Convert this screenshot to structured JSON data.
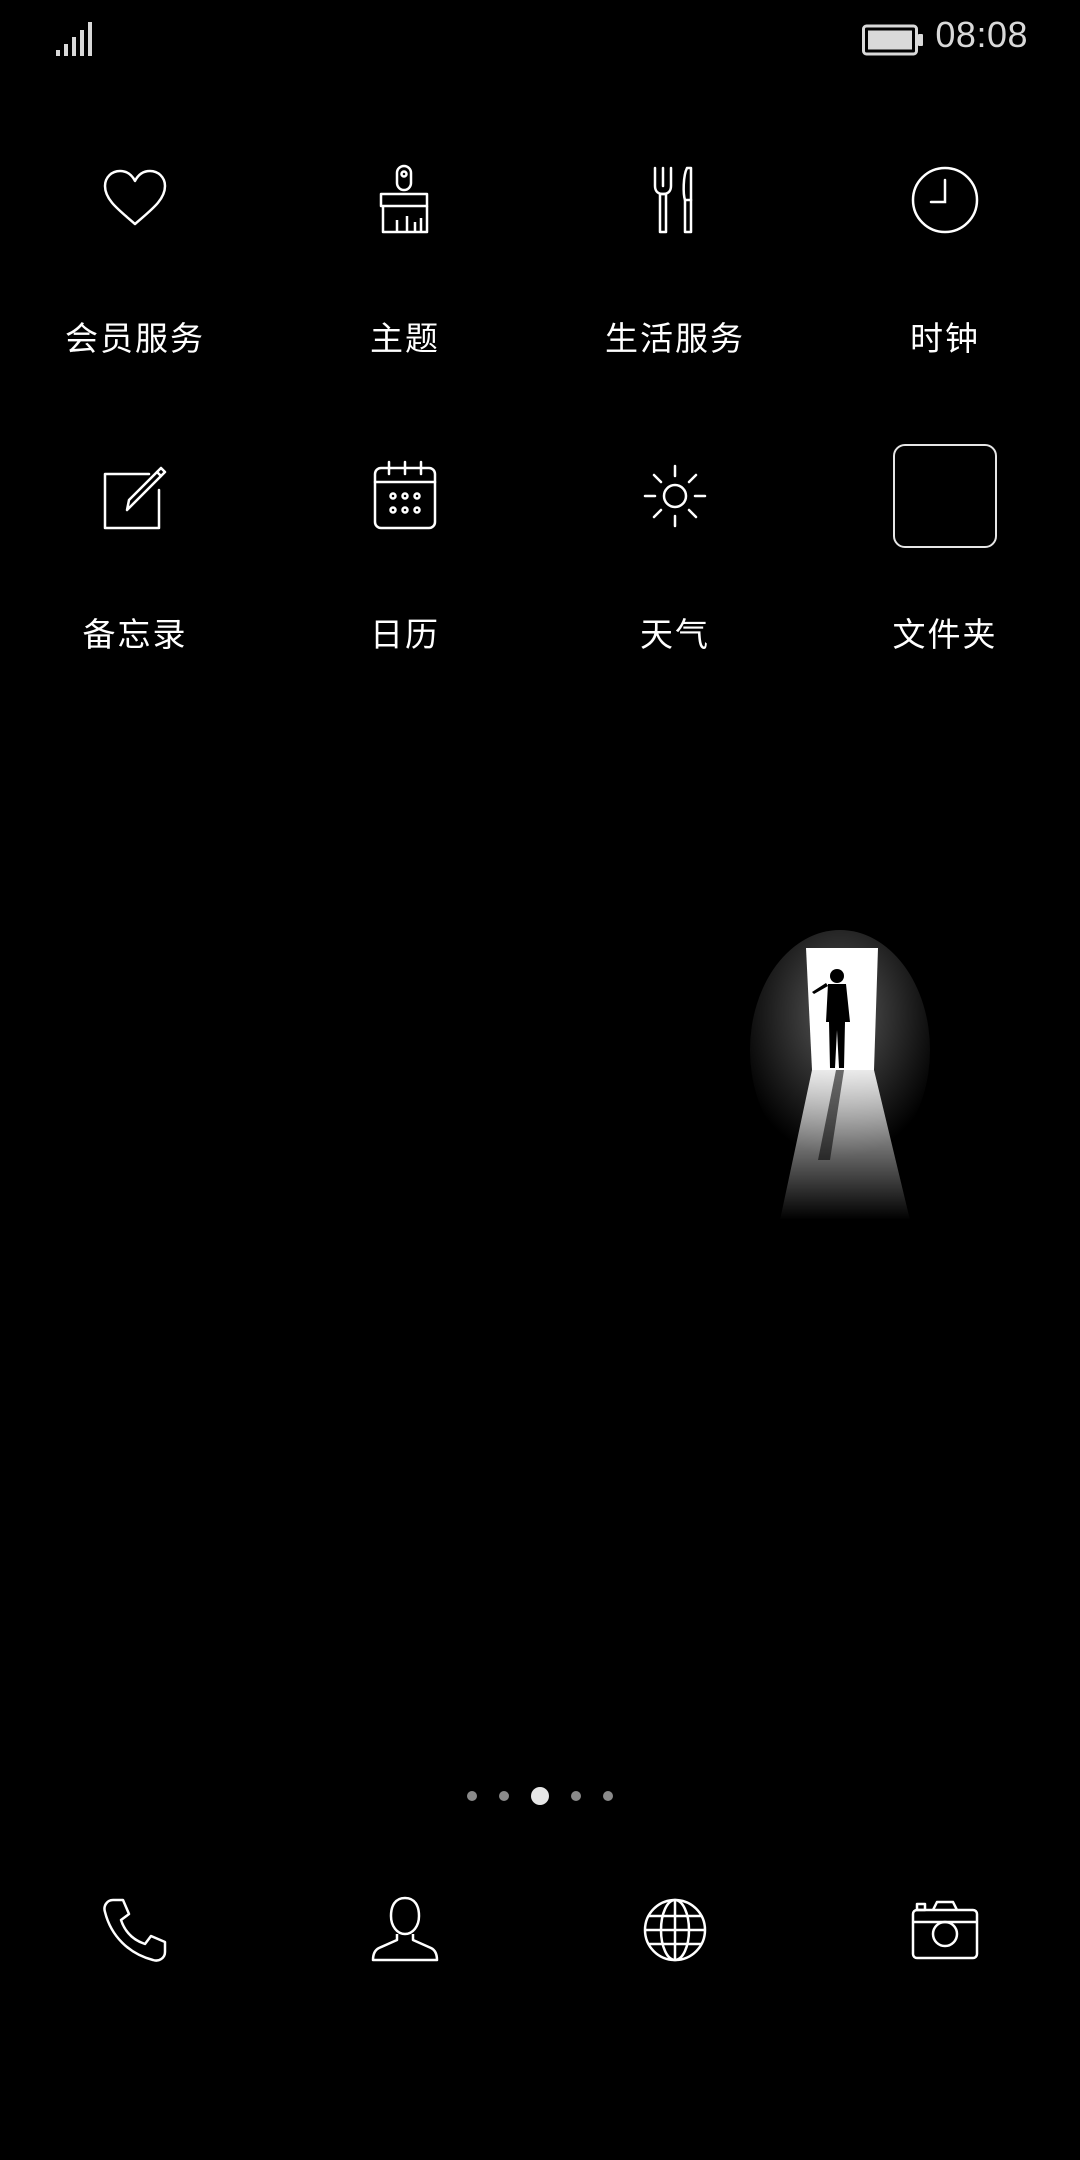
{
  "status_bar": {
    "time": "08:08",
    "signal_icon": "cellular-signal-icon",
    "battery_icon": "battery-icon"
  },
  "apps": [
    {
      "label": "会员服务",
      "icon": "heart-icon"
    },
    {
      "label": "主题",
      "icon": "paintbrush-icon"
    },
    {
      "label": "生活服务",
      "icon": "fork-knife-icon"
    },
    {
      "label": "时钟",
      "icon": "clock-icon"
    },
    {
      "label": "备忘录",
      "icon": "memo-pencil-icon"
    },
    {
      "label": "日历",
      "icon": "calendar-icon"
    },
    {
      "label": "天气",
      "icon": "sun-icon"
    },
    {
      "label": "文件夹",
      "icon": "folder-icon"
    }
  ],
  "page_indicator": {
    "total": 5,
    "active_index": 2
  },
  "dock": [
    {
      "icon": "phone-icon"
    },
    {
      "icon": "contacts-icon"
    },
    {
      "icon": "browser-globe-icon"
    },
    {
      "icon": "camera-icon"
    }
  ],
  "colors": {
    "background": "#000000",
    "icon_stroke": "#ffffff",
    "status_text": "#d9d9d9"
  }
}
